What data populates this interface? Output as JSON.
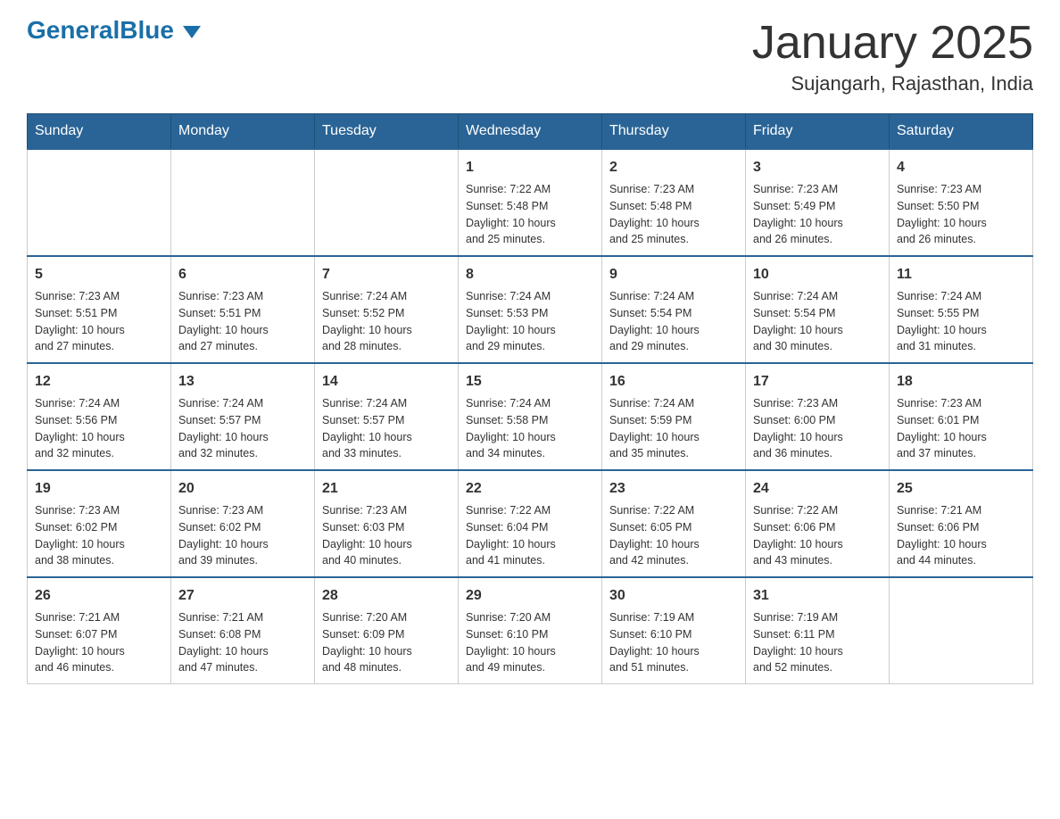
{
  "header": {
    "logo_main": "General",
    "logo_blue": "Blue",
    "month_title": "January 2025",
    "location": "Sujangarh, Rajasthan, India"
  },
  "days_of_week": [
    "Sunday",
    "Monday",
    "Tuesday",
    "Wednesday",
    "Thursday",
    "Friday",
    "Saturday"
  ],
  "weeks": [
    [
      {
        "num": "",
        "info": ""
      },
      {
        "num": "",
        "info": ""
      },
      {
        "num": "",
        "info": ""
      },
      {
        "num": "1",
        "info": "Sunrise: 7:22 AM\nSunset: 5:48 PM\nDaylight: 10 hours\nand 25 minutes."
      },
      {
        "num": "2",
        "info": "Sunrise: 7:23 AM\nSunset: 5:48 PM\nDaylight: 10 hours\nand 25 minutes."
      },
      {
        "num": "3",
        "info": "Sunrise: 7:23 AM\nSunset: 5:49 PM\nDaylight: 10 hours\nand 26 minutes."
      },
      {
        "num": "4",
        "info": "Sunrise: 7:23 AM\nSunset: 5:50 PM\nDaylight: 10 hours\nand 26 minutes."
      }
    ],
    [
      {
        "num": "5",
        "info": "Sunrise: 7:23 AM\nSunset: 5:51 PM\nDaylight: 10 hours\nand 27 minutes."
      },
      {
        "num": "6",
        "info": "Sunrise: 7:23 AM\nSunset: 5:51 PM\nDaylight: 10 hours\nand 27 minutes."
      },
      {
        "num": "7",
        "info": "Sunrise: 7:24 AM\nSunset: 5:52 PM\nDaylight: 10 hours\nand 28 minutes."
      },
      {
        "num": "8",
        "info": "Sunrise: 7:24 AM\nSunset: 5:53 PM\nDaylight: 10 hours\nand 29 minutes."
      },
      {
        "num": "9",
        "info": "Sunrise: 7:24 AM\nSunset: 5:54 PM\nDaylight: 10 hours\nand 29 minutes."
      },
      {
        "num": "10",
        "info": "Sunrise: 7:24 AM\nSunset: 5:54 PM\nDaylight: 10 hours\nand 30 minutes."
      },
      {
        "num": "11",
        "info": "Sunrise: 7:24 AM\nSunset: 5:55 PM\nDaylight: 10 hours\nand 31 minutes."
      }
    ],
    [
      {
        "num": "12",
        "info": "Sunrise: 7:24 AM\nSunset: 5:56 PM\nDaylight: 10 hours\nand 32 minutes."
      },
      {
        "num": "13",
        "info": "Sunrise: 7:24 AM\nSunset: 5:57 PM\nDaylight: 10 hours\nand 32 minutes."
      },
      {
        "num": "14",
        "info": "Sunrise: 7:24 AM\nSunset: 5:57 PM\nDaylight: 10 hours\nand 33 minutes."
      },
      {
        "num": "15",
        "info": "Sunrise: 7:24 AM\nSunset: 5:58 PM\nDaylight: 10 hours\nand 34 minutes."
      },
      {
        "num": "16",
        "info": "Sunrise: 7:24 AM\nSunset: 5:59 PM\nDaylight: 10 hours\nand 35 minutes."
      },
      {
        "num": "17",
        "info": "Sunrise: 7:23 AM\nSunset: 6:00 PM\nDaylight: 10 hours\nand 36 minutes."
      },
      {
        "num": "18",
        "info": "Sunrise: 7:23 AM\nSunset: 6:01 PM\nDaylight: 10 hours\nand 37 minutes."
      }
    ],
    [
      {
        "num": "19",
        "info": "Sunrise: 7:23 AM\nSunset: 6:02 PM\nDaylight: 10 hours\nand 38 minutes."
      },
      {
        "num": "20",
        "info": "Sunrise: 7:23 AM\nSunset: 6:02 PM\nDaylight: 10 hours\nand 39 minutes."
      },
      {
        "num": "21",
        "info": "Sunrise: 7:23 AM\nSunset: 6:03 PM\nDaylight: 10 hours\nand 40 minutes."
      },
      {
        "num": "22",
        "info": "Sunrise: 7:22 AM\nSunset: 6:04 PM\nDaylight: 10 hours\nand 41 minutes."
      },
      {
        "num": "23",
        "info": "Sunrise: 7:22 AM\nSunset: 6:05 PM\nDaylight: 10 hours\nand 42 minutes."
      },
      {
        "num": "24",
        "info": "Sunrise: 7:22 AM\nSunset: 6:06 PM\nDaylight: 10 hours\nand 43 minutes."
      },
      {
        "num": "25",
        "info": "Sunrise: 7:21 AM\nSunset: 6:06 PM\nDaylight: 10 hours\nand 44 minutes."
      }
    ],
    [
      {
        "num": "26",
        "info": "Sunrise: 7:21 AM\nSunset: 6:07 PM\nDaylight: 10 hours\nand 46 minutes."
      },
      {
        "num": "27",
        "info": "Sunrise: 7:21 AM\nSunset: 6:08 PM\nDaylight: 10 hours\nand 47 minutes."
      },
      {
        "num": "28",
        "info": "Sunrise: 7:20 AM\nSunset: 6:09 PM\nDaylight: 10 hours\nand 48 minutes."
      },
      {
        "num": "29",
        "info": "Sunrise: 7:20 AM\nSunset: 6:10 PM\nDaylight: 10 hours\nand 49 minutes."
      },
      {
        "num": "30",
        "info": "Sunrise: 7:19 AM\nSunset: 6:10 PM\nDaylight: 10 hours\nand 51 minutes."
      },
      {
        "num": "31",
        "info": "Sunrise: 7:19 AM\nSunset: 6:11 PM\nDaylight: 10 hours\nand 52 minutes."
      },
      {
        "num": "",
        "info": ""
      }
    ]
  ]
}
